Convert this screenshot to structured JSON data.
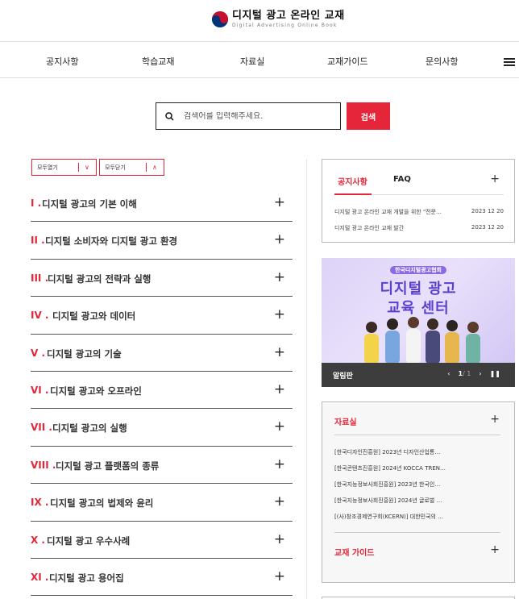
{
  "header": {
    "logo_title": "디지털 광고 온라인 교재",
    "logo_subtitle": "Digital Advertising Online Book"
  },
  "nav": {
    "items": [
      "공지사항",
      "학습교재",
      "자료실",
      "교재가이드",
      "문의사항"
    ]
  },
  "search": {
    "placeholder": "검색어를 입력해주세요.",
    "button_label": "검색"
  },
  "controls": {
    "expand_all": "모두열기",
    "collapse_all": "모두닫기"
  },
  "chapters": [
    {
      "num": "I .",
      "title": "디지털 광고의 기본 이해"
    },
    {
      "num": "II .",
      "title": "디지털 소비자와 디지털 광고 환경"
    },
    {
      "num": "III .",
      "title": "디지털 광고의 전략과 실행"
    },
    {
      "num": "IV .",
      "title": "디지털 광고와 데이터"
    },
    {
      "num": "V .",
      "title": "디지털 광고의 기술"
    },
    {
      "num": "VI .",
      "title": "디지털 광고와 오프라인"
    },
    {
      "num": "VII .",
      "title": "디지털 광고의 실행"
    },
    {
      "num": "VIII .",
      "title": "디지털 광고 플랫폼의 종류"
    },
    {
      "num": "IX .",
      "title": "디지털 광고의 법제와 윤리"
    },
    {
      "num": "X .",
      "title": "디지털 광고 우수사례"
    },
    {
      "num": "XI .",
      "title": "디지털 광고 용어집"
    }
  ],
  "notice": {
    "tabs": [
      "공지사항",
      "FAQ"
    ],
    "rows": [
      {
        "title": "디지털 광고 온라인 교재 개발을 위한 \"전문…",
        "date": "2023 12 20"
      },
      {
        "title": "디지털 광고 온라인 교재 발간",
        "date": "2023 12 20"
      }
    ]
  },
  "banner": {
    "badge": "한국디지털광고협회",
    "title_line1": "디지털 광고",
    "title_line2": "교육 센터",
    "bar_label": "알림판",
    "page_current": "1",
    "page_total": "/ 1"
  },
  "resources": {
    "title": "자료실",
    "items": [
      "[한국디자인진흥원] 2023년 디자인산업통…",
      "[한국콘텐츠진흥원] 2024년 KOCCA TREN…",
      "[한국지능정보사회진흥원] 2023년 한국인…",
      "[한국지능정보사회진흥원] 2024년 글로벌 …",
      "[(사)창조경제연구회(KCERN)] 대한민국의 …"
    ],
    "guide_title": "교재 가이드"
  },
  "colors": {
    "accent": "#e5263a",
    "banner_purple": "#5c3fd0",
    "bar_dark": "#3d3d3d"
  }
}
